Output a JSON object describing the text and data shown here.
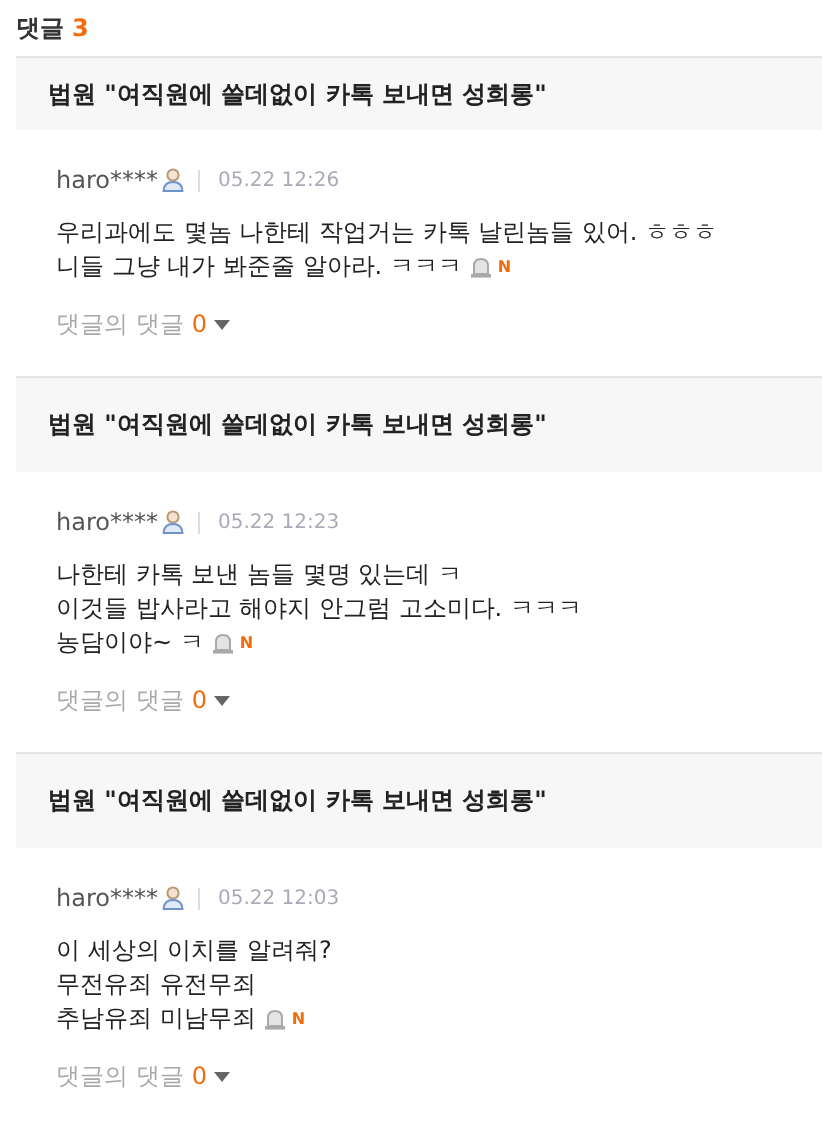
{
  "header": {
    "label": "댓글",
    "count": "3"
  },
  "comments": [
    {
      "title": "법원 \"여직원에 쓸데없이 카톡 보내면 성희롱\"",
      "author": "haro****",
      "time": "05.22 12:26",
      "lines": [
        "우리과에도 몇놈 나한테 작업거는 카톡 날린놈들 있어. ㅎㅎㅎ",
        "니들 그냥 내가 봐준줄 알아라. ㅋㅋㅋ"
      ],
      "badge": "N",
      "replies_label": "댓글의 댓글",
      "replies_count": "0"
    },
    {
      "title": "법원 \"여직원에 쓸데없이 카톡 보내면 성희롱\"",
      "author": "haro****",
      "time": "05.22 12:23",
      "lines": [
        "나한테 카톡 보낸 놈들 몇명 있는데 ㅋ",
        "이것들 밥사라고 해야지 안그럼 고소미다. ㅋㅋㅋ",
        "농담이야~ ㅋ"
      ],
      "badge": "N",
      "replies_label": "댓글의 댓글",
      "replies_count": "0"
    },
    {
      "title": "법원 \"여직원에 쓸데없이 카톡 보내면 성희롱\"",
      "author": "haro****",
      "time": "05.22 12:03",
      "lines": [
        "이 세상의 이치를 알려줘?",
        "무전유죄 유전무죄",
        "추남유죄 미남무죄"
      ],
      "badge": "N",
      "replies_label": "댓글의 댓글",
      "replies_count": "0"
    }
  ]
}
